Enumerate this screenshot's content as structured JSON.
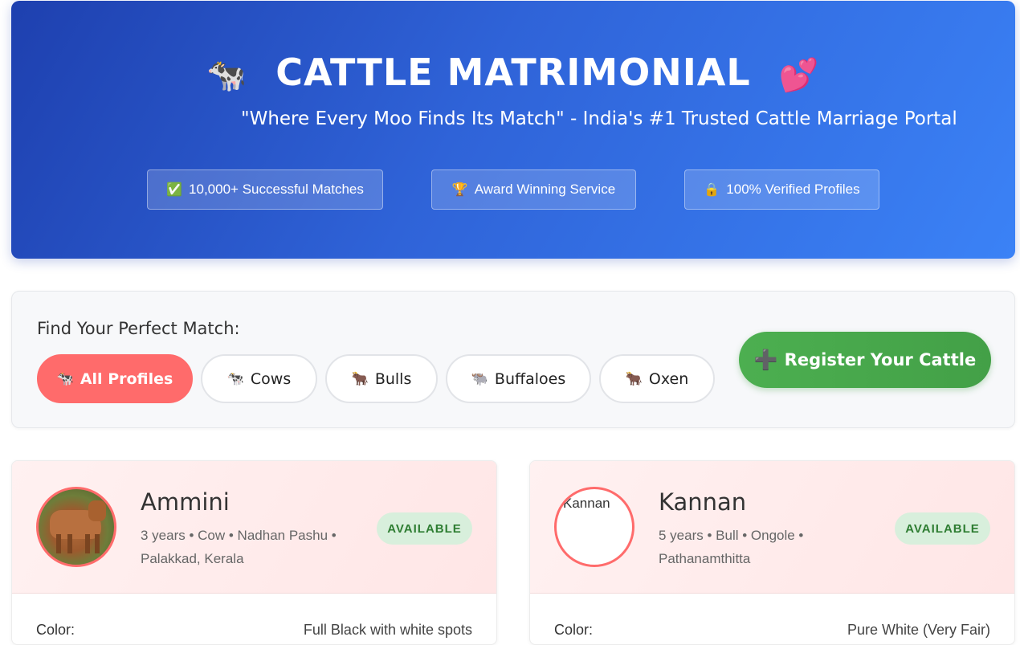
{
  "hero": {
    "title": "CATTLE MATRIMONIAL",
    "title_icon_left": "🐄",
    "title_icon_right": "💕",
    "subtitle": "\"Where Every Moo Finds Its Match\" - India's #1 Trusted Cattle Marriage Portal",
    "badges": [
      {
        "icon": "✅",
        "label": "10,000+ Successful Matches"
      },
      {
        "icon": "🏆",
        "label": "Award Winning Service"
      },
      {
        "icon": "🔒",
        "label": "100% Verified Profiles"
      }
    ]
  },
  "filters": {
    "title": "Find Your Perfect Match:",
    "chips": [
      {
        "icon": "🐄",
        "label": "All Profiles",
        "active": true
      },
      {
        "icon": "🐄",
        "label": "Cows",
        "active": false
      },
      {
        "icon": "🐂",
        "label": "Bulls",
        "active": false
      },
      {
        "icon": "🐃",
        "label": "Buffaloes",
        "active": false
      },
      {
        "icon": "🐂",
        "label": "Oxen",
        "active": false
      }
    ],
    "register": {
      "icon": "➕",
      "label": "Register Your Cattle"
    }
  },
  "profiles": [
    {
      "name": "Ammini",
      "meta_line1": "3 years • Cow • Nadhan Pashu •",
      "meta_line2": "Palakkad, Kerala",
      "status": "AVAILABLE",
      "detail_label": "Color:",
      "detail_value": "Full Black with white spots",
      "photo_alt": ""
    },
    {
      "name": "Kannan",
      "meta_line1": "5 years • Bull • Ongole •",
      "meta_line2": "Pathanamthitta",
      "status": "AVAILABLE",
      "detail_label": "Color:",
      "detail_value": "Pure White (Very Fair)",
      "photo_alt": "Kannan"
    }
  ],
  "colors": {
    "hero_gradient_start": "#1e40af",
    "hero_gradient_end": "#3b82f6",
    "accent_active_chip": "#ff6b6b",
    "register_green": "#4caf50",
    "status_bg": "#d8efdc",
    "status_text": "#2e7d32"
  }
}
